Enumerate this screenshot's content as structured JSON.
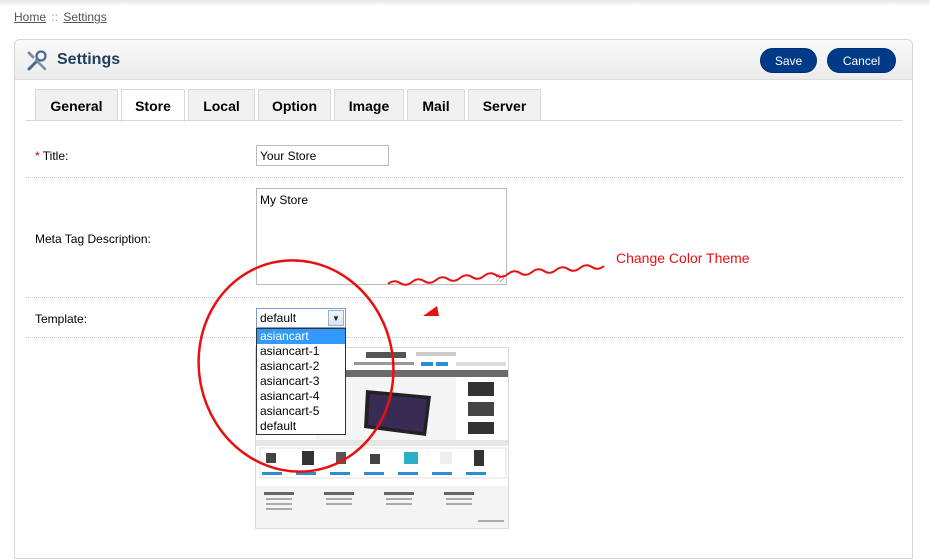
{
  "breadcrumb": {
    "home": "Home",
    "separator": "::",
    "current": "Settings"
  },
  "header": {
    "title": "Settings",
    "icon": "tools-icon",
    "save_label": "Save",
    "cancel_label": "Cancel"
  },
  "tabs": [
    {
      "label": "General",
      "active": false
    },
    {
      "label": "Store",
      "active": true
    },
    {
      "label": "Local",
      "active": false
    },
    {
      "label": "Option",
      "active": false
    },
    {
      "label": "Image",
      "active": false
    },
    {
      "label": "Mail",
      "active": false
    },
    {
      "label": "Server",
      "active": false
    }
  ],
  "form": {
    "title": {
      "required_mark": "*",
      "label": "Title:",
      "value": "Your Store"
    },
    "meta": {
      "label": "Meta Tag Description:",
      "value": "My Store"
    },
    "template": {
      "label": "Template:",
      "selected": "default",
      "options": [
        "asiancart",
        "asiancart-1",
        "asiancart-2",
        "asiancart-3",
        "asiancart-4",
        "asiancart-5",
        "default"
      ],
      "highlighted": "asiancart"
    }
  },
  "annotation": {
    "text": "Change Color Theme",
    "color": "#e81010"
  },
  "colors": {
    "accent": "#003a88",
    "title": "#1e3e62",
    "annotation": "#e81010"
  }
}
